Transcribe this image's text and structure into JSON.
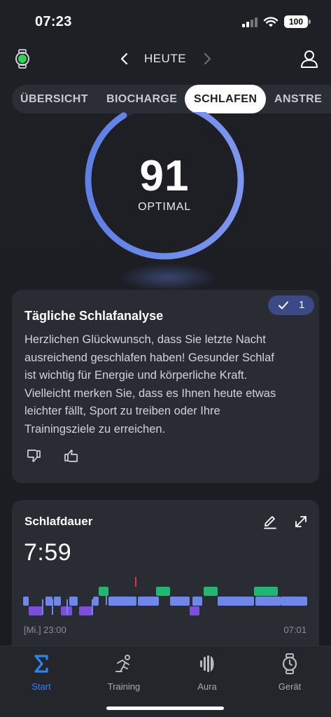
{
  "status_bar": {
    "time": "07:23",
    "battery": "100"
  },
  "nav": {
    "title": "HEUTE"
  },
  "tabs": [
    {
      "label": "ÜBERSICHT",
      "active": false
    },
    {
      "label": "BIOCHARGE",
      "active": false
    },
    {
      "label": "SCHLAFEN",
      "active": true
    },
    {
      "label": "ANSTRE",
      "active": false
    }
  ],
  "score": {
    "value": "91",
    "label": "OPTIMAL",
    "ring_fill_fraction": 0.91,
    "ring_color": "#6a86ea"
  },
  "analysis": {
    "title": "Tägliche Schlafanalyse",
    "feedback_count": "1",
    "body_lines": [
      "Herzlichen Glückwunsch, dass Sie letzte Nacht",
      "ausreichend geschlafen haben! Gesunder Schlaf",
      "ist wichtig für Energie und körperliche Kraft.",
      "Vielleicht merken Sie, dass es Ihnen heute etwas",
      "leichter fällt, Sport zu treiben oder Ihre",
      "Trainingsziele zu erreichen."
    ]
  },
  "sleep_duration": {
    "title": "Schlafdauer",
    "value": "7:59",
    "start_label": "[Mi.] 23:00",
    "end_label": "07:01",
    "stage_colors": {
      "awake": "#22b573",
      "light": "#6f88e8",
      "deep": "#7b4fd8",
      "marker": "#e0353b"
    }
  },
  "tab_bar": [
    {
      "label": "Start",
      "icon": "sigma-icon",
      "active": true
    },
    {
      "label": "Training",
      "icon": "running-icon",
      "active": false
    },
    {
      "label": "Aura",
      "icon": "aura-icon",
      "active": false
    },
    {
      "label": "Gerät",
      "icon": "watch-icon",
      "active": false
    }
  ]
}
